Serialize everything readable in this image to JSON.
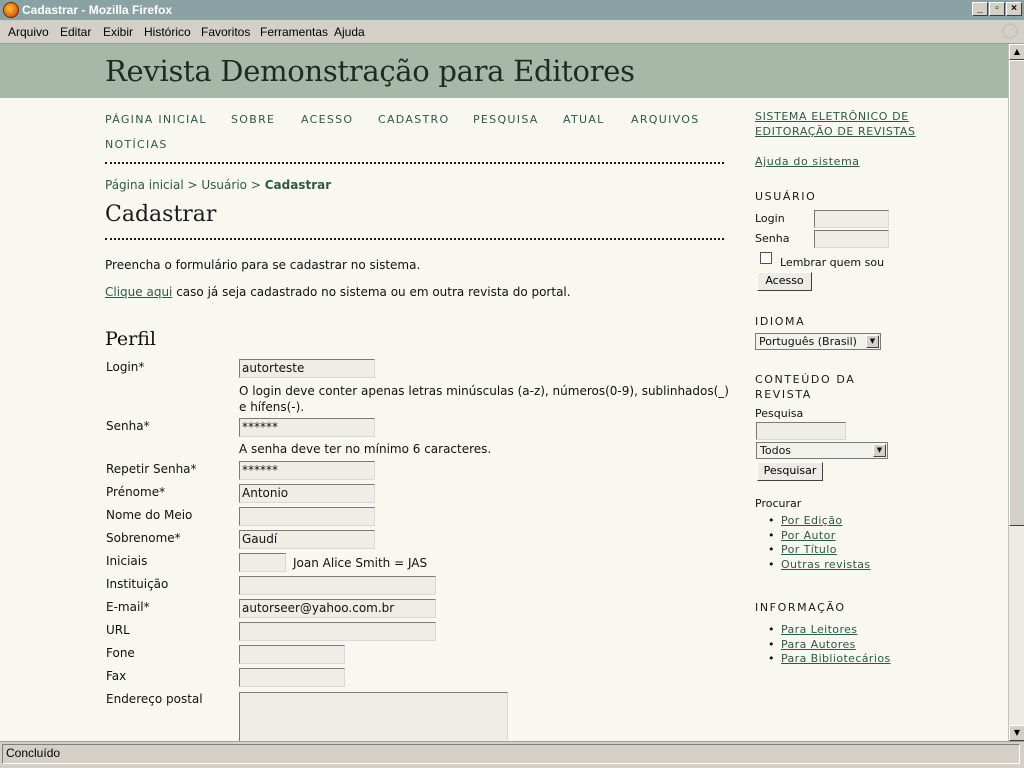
{
  "window": {
    "title": "Cadastrar - Mozilla Firefox"
  },
  "menubar": {
    "items": [
      "Arquivo",
      "Editar",
      "Exibir",
      "Histórico",
      "Favoritos",
      "Ferramentas",
      "Ajuda"
    ]
  },
  "status": {
    "text": "Concluído"
  },
  "site": {
    "title": "Revista Demonstração para Editores"
  },
  "nav": {
    "items": [
      "PÁGINA INICIAL",
      "SOBRE",
      "ACESSO",
      "CADASTRO",
      "PESQUISA",
      "ATUAL",
      "ARQUIVOS",
      "NOTÍCIAS"
    ]
  },
  "breadcrumb": {
    "home": "Página inicial",
    "sep": ">",
    "user": "Usuário",
    "current": "Cadastrar"
  },
  "page": {
    "title": "Cadastrar",
    "intro": "Preencha o formulário para se cadastrar no sistema.",
    "login_link": "Clique aqui",
    "login_text": " caso já seja cadastrado no sistema ou em outra revista do portal."
  },
  "form": {
    "section": "Perfil",
    "login_label": "Login*",
    "login_value": "autorteste",
    "login_hint": "O login deve conter apenas letras minúsculas (a-z), números(0-9), sublinhados(_) e hífens(-).",
    "password_label": "Senha*",
    "password_value": "******",
    "password_hint": "A senha deve ter no mínimo 6 caracteres.",
    "repeat_label": "Repetir Senha*",
    "repeat_value": "******",
    "firstname_label": "Prénome*",
    "firstname_value": "Antonio",
    "middlename_label": "Nome do Meio",
    "middlename_value": "",
    "lastname_label": "Sobrenome*",
    "lastname_value": "Gaudí",
    "initials_label": "Iniciais",
    "initials_value": "",
    "initials_hint": "Joan Alice Smith = JAS",
    "institution_label": "Instituição",
    "institution_value": "",
    "email_label": "E-mail*",
    "email_value": "autorseer@yahoo.com.br",
    "url_label": "URL",
    "url_value": "",
    "phone_label": "Fone",
    "phone_value": "",
    "fax_label": "Fax",
    "fax_value": "",
    "address_label": "Endereço postal"
  },
  "sidebar": {
    "system_link_1": "SISTEMA ELETRÔNICO DE",
    "system_link_2": "EDITORAÇÃO DE REVISTAS",
    "help_link": "Ajuda do sistema",
    "user_heading": "USUÁRIO",
    "login_label": "Login",
    "password_label": "Senha",
    "remember_label": "Lembrar quem sou",
    "access_button": "Acesso",
    "language_heading": "IDIOMA",
    "language_value": "Português (Brasil)",
    "content_heading_1": "CONTEÚDO DA",
    "content_heading_2": "REVISTA",
    "search_label": "Pesquisa",
    "search_scope": "Todos",
    "search_button": "Pesquisar",
    "browse_label": "Procurar",
    "browse_items": [
      "Por Edição",
      "Por Autor",
      "Por Título",
      "Outras revistas"
    ],
    "info_heading": "INFORMAÇÃO",
    "info_items": [
      "Para Leitores",
      "Para Autores",
      "Para Bibliotecários"
    ]
  }
}
